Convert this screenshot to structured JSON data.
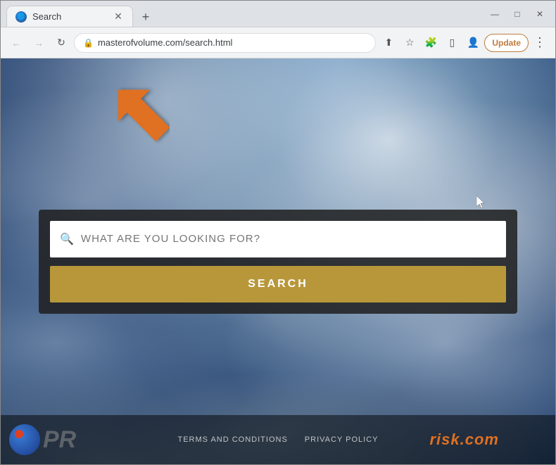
{
  "browser": {
    "tab": {
      "title": "Search",
      "favicon": "🌐"
    },
    "new_tab_label": "+",
    "window_controls": {
      "minimize": "—",
      "maximize": "□",
      "close": "✕"
    },
    "nav": {
      "back": "←",
      "forward": "→",
      "reload": "↻"
    },
    "address": "masterofvolume.com/search.html",
    "toolbar": {
      "share": "⬆",
      "bookmark": "☆",
      "extensions": "🧩",
      "sidebar": "▯",
      "profile": "👤",
      "update_label": "Update",
      "menu": "⋮"
    }
  },
  "page": {
    "search_placeholder": "WHAT ARE YOU LOOKING FOR?",
    "search_button_label": "SEARCH",
    "footer": {
      "terms_label": "TERMS AND CONDITIONS",
      "privacy_label": "PRIVACY POLICY",
      "brand_label": "risk.com"
    }
  }
}
